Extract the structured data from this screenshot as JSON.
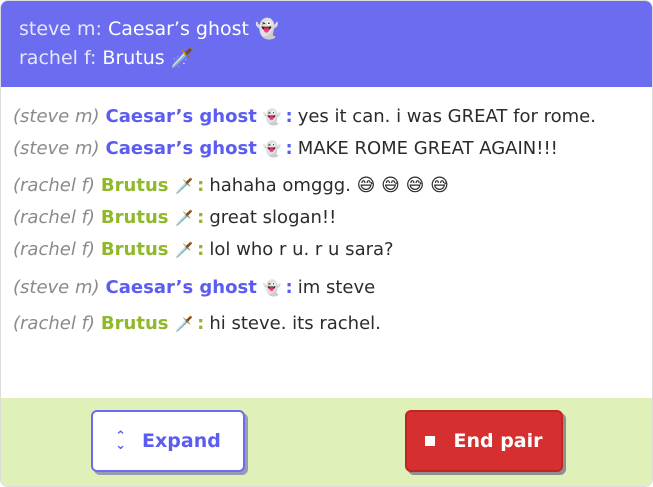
{
  "header": {
    "line1_who": "steve m:",
    "line1_name": "Caesar’s ghost",
    "line1_emoji": "👻",
    "line2_who": "rachel f:",
    "line2_name": "Brutus",
    "line2_emoji": "🗡️"
  },
  "messages": [
    {
      "who": "(steve m)",
      "name": "Caesar’s ghost",
      "emoji": "👻",
      "colon": ":",
      "text": "yes it can. i was GREAT for rome."
    },
    {
      "who": "(steve m)",
      "name": "Caesar’s ghost",
      "emoji": "👻",
      "colon": ":",
      "text": "MAKE ROME GREAT AGAIN!!!"
    },
    {
      "who": "(rachel f)",
      "name": "Brutus",
      "emoji": "🗡️",
      "colon": ":",
      "text": "hahaha omggg. 😅 😅 😅 😅"
    },
    {
      "who": "(rachel f)",
      "name": "Brutus",
      "emoji": "🗡️",
      "colon": ":",
      "text": "great slogan!!"
    },
    {
      "who": "(rachel f)",
      "name": "Brutus",
      "emoji": "🗡️",
      "colon": ":",
      "text": "lol who r u. r u sara?"
    },
    {
      "who": "(steve m)",
      "name": "Caesar’s ghost",
      "emoji": "👻",
      "colon": ":",
      "text": "im steve"
    },
    {
      "who": "(rachel f)",
      "name": "Brutus",
      "emoji": "🗡️",
      "colon": ":",
      "text": "hi steve. its rachel."
    }
  ],
  "footer": {
    "expand_label": "Expand",
    "end_label": "End pair",
    "expand_icon": "chevron-up-down-icon",
    "end_icon": "stop-square-icon"
  },
  "colors": {
    "header_bg": "#6b6cf0",
    "steve": "#5b5cf0",
    "rachel": "#8fb82a",
    "footer_bg": "#dff0b8",
    "end_button": "#d62f2f"
  }
}
